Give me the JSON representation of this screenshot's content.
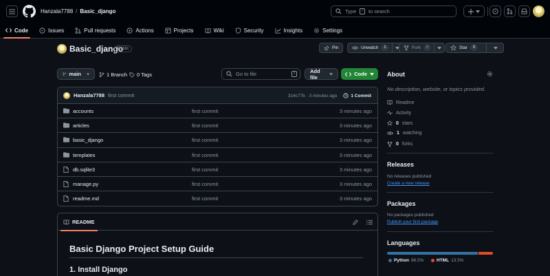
{
  "header": {
    "owner": "Hanzala7788",
    "separator": "/",
    "repo": "Basic_django",
    "search_prefix": "Type",
    "search_key": "/",
    "search_suffix": "to search"
  },
  "tabs": [
    {
      "label": "Code"
    },
    {
      "label": "Issues"
    },
    {
      "label": "Pull requests"
    },
    {
      "label": "Actions"
    },
    {
      "label": "Projects"
    },
    {
      "label": "Wiki"
    },
    {
      "label": "Security"
    },
    {
      "label": "Insights"
    },
    {
      "label": "Settings"
    }
  ],
  "repo": {
    "name": "Basic_django",
    "visibility": "Public",
    "pin": "Pin",
    "unwatch": "Unwatch",
    "watch_count": "1",
    "fork": "Fork",
    "fork_count": "0",
    "star": "Star",
    "star_count": "0"
  },
  "toolbar": {
    "branch": "main",
    "branches": "1 Branch",
    "tags": "0 Tags",
    "goto_placeholder": "Go to file",
    "goto_key": "t",
    "add_file": "Add file",
    "code": "Code"
  },
  "commit": {
    "author": "Hanzala7788",
    "message": "first commit",
    "meta": "314c77b · 3 minutes ago",
    "count": "1 Commit"
  },
  "files": [
    {
      "name": "accounts",
      "type": "folder",
      "message": "first commit",
      "time": "3 minutes ago"
    },
    {
      "name": "articles",
      "type": "folder",
      "message": "first commit",
      "time": "3 minutes ago"
    },
    {
      "name": "basic_django",
      "type": "folder",
      "message": "first commit",
      "time": "3 minutes ago"
    },
    {
      "name": "templates",
      "type": "folder",
      "message": "first commit",
      "time": "3 minutes ago"
    },
    {
      "name": "db.sqlite3",
      "type": "file",
      "message": "first commit",
      "time": "3 minutes ago"
    },
    {
      "name": "manage.py",
      "type": "file",
      "message": "first commit",
      "time": "3 minutes ago"
    },
    {
      "name": "readme.md",
      "type": "file",
      "message": "first commit",
      "time": "3 minutes ago"
    }
  ],
  "readme": {
    "tab": "README",
    "h1": "Basic Django Project Setup Guide",
    "h2": "1. Install Django"
  },
  "about": {
    "title": "About",
    "description": "No description, website, or topics provided.",
    "readme": "Readme",
    "activity": "Activity",
    "stars_count": "0",
    "stars_label": "stars",
    "watching_count": "1",
    "watching_label": "watching",
    "forks_count": "0",
    "forks_label": "forks"
  },
  "releases": {
    "title": "Releases",
    "none": "No releases published",
    "create": "Create a new release"
  },
  "packages": {
    "title": "Packages",
    "none": "No packages published",
    "publish": "Publish your first package"
  },
  "languages": {
    "title": "Languages",
    "items": [
      {
        "name": "Python",
        "percent": "86.5%",
        "color": "#3572A5",
        "share": 86.5
      },
      {
        "name": "HTML",
        "percent": "13.5%",
        "color": "#e34c26",
        "share": 13.5
      }
    ]
  }
}
